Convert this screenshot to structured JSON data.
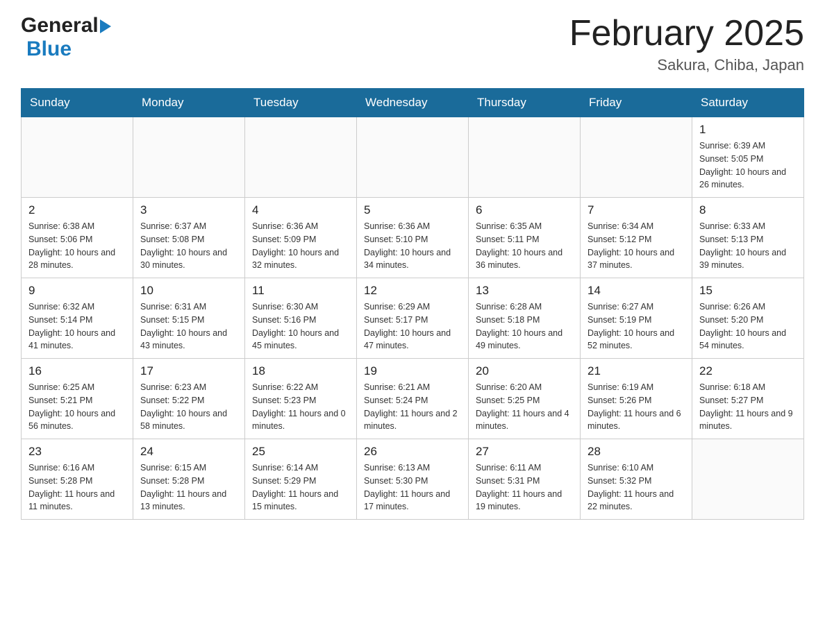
{
  "header": {
    "title": "February 2025",
    "location": "Sakura, Chiba, Japan"
  },
  "logo": {
    "general": "General",
    "blue": "Blue"
  },
  "weekdays": [
    "Sunday",
    "Monday",
    "Tuesday",
    "Wednesday",
    "Thursday",
    "Friday",
    "Saturday"
  ],
  "weeks": [
    [
      {
        "day": "",
        "sunrise": "",
        "sunset": "",
        "daylight": ""
      },
      {
        "day": "",
        "sunrise": "",
        "sunset": "",
        "daylight": ""
      },
      {
        "day": "",
        "sunrise": "",
        "sunset": "",
        "daylight": ""
      },
      {
        "day": "",
        "sunrise": "",
        "sunset": "",
        "daylight": ""
      },
      {
        "day": "",
        "sunrise": "",
        "sunset": "",
        "daylight": ""
      },
      {
        "day": "",
        "sunrise": "",
        "sunset": "",
        "daylight": ""
      },
      {
        "day": "1",
        "sunrise": "Sunrise: 6:39 AM",
        "sunset": "Sunset: 5:05 PM",
        "daylight": "Daylight: 10 hours and 26 minutes."
      }
    ],
    [
      {
        "day": "2",
        "sunrise": "Sunrise: 6:38 AM",
        "sunset": "Sunset: 5:06 PM",
        "daylight": "Daylight: 10 hours and 28 minutes."
      },
      {
        "day": "3",
        "sunrise": "Sunrise: 6:37 AM",
        "sunset": "Sunset: 5:08 PM",
        "daylight": "Daylight: 10 hours and 30 minutes."
      },
      {
        "day": "4",
        "sunrise": "Sunrise: 6:36 AM",
        "sunset": "Sunset: 5:09 PM",
        "daylight": "Daylight: 10 hours and 32 minutes."
      },
      {
        "day": "5",
        "sunrise": "Sunrise: 6:36 AM",
        "sunset": "Sunset: 5:10 PM",
        "daylight": "Daylight: 10 hours and 34 minutes."
      },
      {
        "day": "6",
        "sunrise": "Sunrise: 6:35 AM",
        "sunset": "Sunset: 5:11 PM",
        "daylight": "Daylight: 10 hours and 36 minutes."
      },
      {
        "day": "7",
        "sunrise": "Sunrise: 6:34 AM",
        "sunset": "Sunset: 5:12 PM",
        "daylight": "Daylight: 10 hours and 37 minutes."
      },
      {
        "day": "8",
        "sunrise": "Sunrise: 6:33 AM",
        "sunset": "Sunset: 5:13 PM",
        "daylight": "Daylight: 10 hours and 39 minutes."
      }
    ],
    [
      {
        "day": "9",
        "sunrise": "Sunrise: 6:32 AM",
        "sunset": "Sunset: 5:14 PM",
        "daylight": "Daylight: 10 hours and 41 minutes."
      },
      {
        "day": "10",
        "sunrise": "Sunrise: 6:31 AM",
        "sunset": "Sunset: 5:15 PM",
        "daylight": "Daylight: 10 hours and 43 minutes."
      },
      {
        "day": "11",
        "sunrise": "Sunrise: 6:30 AM",
        "sunset": "Sunset: 5:16 PM",
        "daylight": "Daylight: 10 hours and 45 minutes."
      },
      {
        "day": "12",
        "sunrise": "Sunrise: 6:29 AM",
        "sunset": "Sunset: 5:17 PM",
        "daylight": "Daylight: 10 hours and 47 minutes."
      },
      {
        "day": "13",
        "sunrise": "Sunrise: 6:28 AM",
        "sunset": "Sunset: 5:18 PM",
        "daylight": "Daylight: 10 hours and 49 minutes."
      },
      {
        "day": "14",
        "sunrise": "Sunrise: 6:27 AM",
        "sunset": "Sunset: 5:19 PM",
        "daylight": "Daylight: 10 hours and 52 minutes."
      },
      {
        "day": "15",
        "sunrise": "Sunrise: 6:26 AM",
        "sunset": "Sunset: 5:20 PM",
        "daylight": "Daylight: 10 hours and 54 minutes."
      }
    ],
    [
      {
        "day": "16",
        "sunrise": "Sunrise: 6:25 AM",
        "sunset": "Sunset: 5:21 PM",
        "daylight": "Daylight: 10 hours and 56 minutes."
      },
      {
        "day": "17",
        "sunrise": "Sunrise: 6:23 AM",
        "sunset": "Sunset: 5:22 PM",
        "daylight": "Daylight: 10 hours and 58 minutes."
      },
      {
        "day": "18",
        "sunrise": "Sunrise: 6:22 AM",
        "sunset": "Sunset: 5:23 PM",
        "daylight": "Daylight: 11 hours and 0 minutes."
      },
      {
        "day": "19",
        "sunrise": "Sunrise: 6:21 AM",
        "sunset": "Sunset: 5:24 PM",
        "daylight": "Daylight: 11 hours and 2 minutes."
      },
      {
        "day": "20",
        "sunrise": "Sunrise: 6:20 AM",
        "sunset": "Sunset: 5:25 PM",
        "daylight": "Daylight: 11 hours and 4 minutes."
      },
      {
        "day": "21",
        "sunrise": "Sunrise: 6:19 AM",
        "sunset": "Sunset: 5:26 PM",
        "daylight": "Daylight: 11 hours and 6 minutes."
      },
      {
        "day": "22",
        "sunrise": "Sunrise: 6:18 AM",
        "sunset": "Sunset: 5:27 PM",
        "daylight": "Daylight: 11 hours and 9 minutes."
      }
    ],
    [
      {
        "day": "23",
        "sunrise": "Sunrise: 6:16 AM",
        "sunset": "Sunset: 5:28 PM",
        "daylight": "Daylight: 11 hours and 11 minutes."
      },
      {
        "day": "24",
        "sunrise": "Sunrise: 6:15 AM",
        "sunset": "Sunset: 5:28 PM",
        "daylight": "Daylight: 11 hours and 13 minutes."
      },
      {
        "day": "25",
        "sunrise": "Sunrise: 6:14 AM",
        "sunset": "Sunset: 5:29 PM",
        "daylight": "Daylight: 11 hours and 15 minutes."
      },
      {
        "day": "26",
        "sunrise": "Sunrise: 6:13 AM",
        "sunset": "Sunset: 5:30 PM",
        "daylight": "Daylight: 11 hours and 17 minutes."
      },
      {
        "day": "27",
        "sunrise": "Sunrise: 6:11 AM",
        "sunset": "Sunset: 5:31 PM",
        "daylight": "Daylight: 11 hours and 19 minutes."
      },
      {
        "day": "28",
        "sunrise": "Sunrise: 6:10 AM",
        "sunset": "Sunset: 5:32 PM",
        "daylight": "Daylight: 11 hours and 22 minutes."
      },
      {
        "day": "",
        "sunrise": "",
        "sunset": "",
        "daylight": ""
      }
    ]
  ]
}
